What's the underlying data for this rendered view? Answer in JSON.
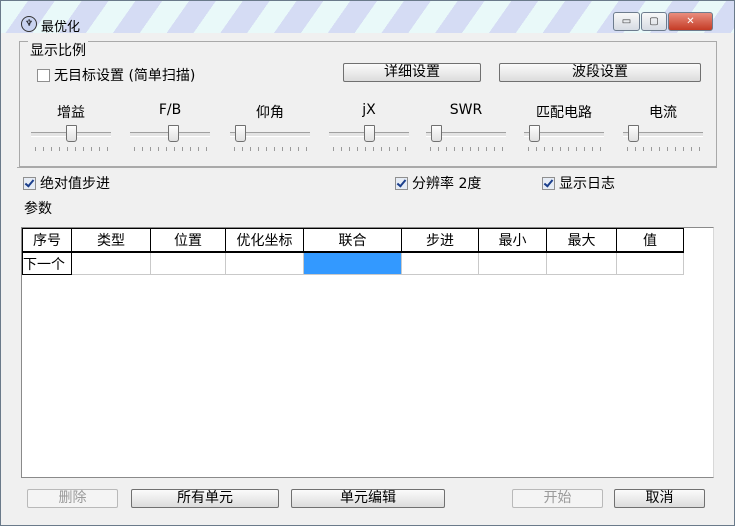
{
  "window": {
    "title": "最优化",
    "minimize_glyph": "▭",
    "maximize_glyph": "▢",
    "close_glyph": "✕",
    "app_icon": "antenna-icon"
  },
  "group": {
    "title": "显示比例"
  },
  "no_target_checkbox": {
    "label": "无目标设置 (简单扫描)",
    "checked": false
  },
  "buttons": {
    "detail": "详细设置",
    "band": "波段设置",
    "delete": "删除",
    "all_cells": "所有单元",
    "cell_edit": "单元编辑",
    "start": "开始",
    "cancel": "取消"
  },
  "sliders": [
    {
      "label": "增益",
      "level": 0.5
    },
    {
      "label": "F/B",
      "level": 0.55
    },
    {
      "label": "仰角",
      "level": 0.05
    },
    {
      "label": "jX",
      "level": 0.5
    },
    {
      "label": "SWR",
      "level": 0.05
    },
    {
      "label": "匹配电路",
      "level": 0.05
    },
    {
      "label": "电流",
      "level": 0.05
    }
  ],
  "options": {
    "abs_step": {
      "label": "绝对值步进",
      "checked": true
    },
    "resolution": {
      "label": "分辨率 2度",
      "checked": true
    },
    "show_log": {
      "label": "显示日志",
      "checked": true
    }
  },
  "params_label": "参数",
  "table": {
    "columns": [
      "序号",
      "类型",
      "位置",
      "优化坐标",
      "联合",
      "步进",
      "最小",
      "最大",
      "值"
    ],
    "rows": [
      [
        "下一个",
        "",
        "",
        "",
        "",
        "",
        "",
        "",
        ""
      ]
    ],
    "selected_cell": {
      "row": 0,
      "col": 4
    }
  }
}
